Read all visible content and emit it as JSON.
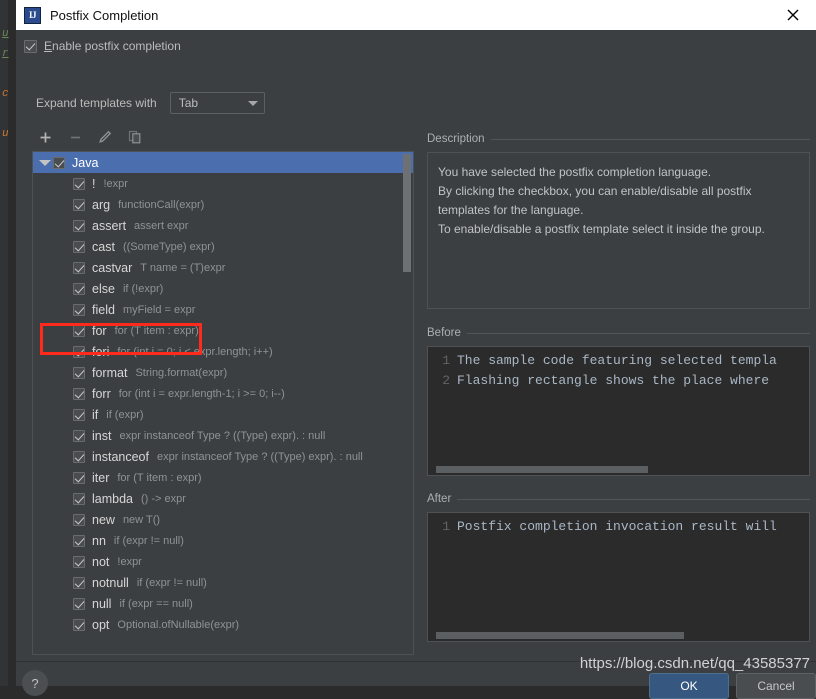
{
  "window": {
    "title": "Postfix Completion",
    "icon": "intellij-idea-icon",
    "close_icon": "close-icon"
  },
  "options": {
    "enable_checkbox_label": "Enable postfix completion",
    "enable_checkbox_mnemonic": "E",
    "enable_checked": true,
    "expand_label": "Expand templates with",
    "expand_value": "Tab"
  },
  "tree_toolbar": {
    "buttons": [
      {
        "name": "add-button",
        "icon": "plus-icon",
        "enabled": true
      },
      {
        "name": "remove-button",
        "icon": "minus-icon",
        "enabled": false
      },
      {
        "name": "edit-button",
        "icon": "pencil-icon",
        "enabled": false
      },
      {
        "name": "copy-button",
        "icon": "copy-icon",
        "enabled": false
      }
    ]
  },
  "tree": {
    "group": {
      "label": "Java",
      "checked": true,
      "expanded": true,
      "selected": true
    },
    "items": [
      {
        "name": "!",
        "desc": "!expr",
        "checked": true
      },
      {
        "name": "arg",
        "desc": "functionCall(expr)",
        "checked": true
      },
      {
        "name": "assert",
        "desc": "assert expr",
        "checked": true
      },
      {
        "name": "cast",
        "desc": "((SomeType) expr)",
        "checked": true
      },
      {
        "name": "castvar",
        "desc": "T name = (T)expr",
        "checked": true
      },
      {
        "name": "else",
        "desc": "if (!expr)",
        "checked": true
      },
      {
        "name": "field",
        "desc": "myField = expr",
        "checked": true
      },
      {
        "name": "for",
        "desc": "for (T item : expr)",
        "checked": true,
        "highlighted": true
      },
      {
        "name": "fori",
        "desc": "for (int i = 0; i < expr.length; i++)",
        "checked": true
      },
      {
        "name": "format",
        "desc": "String.format(expr)",
        "checked": true
      },
      {
        "name": "forr",
        "desc": "for (int i = expr.length-1; i >= 0; i--)",
        "checked": true
      },
      {
        "name": "if",
        "desc": "if (expr)",
        "checked": true
      },
      {
        "name": "inst",
        "desc": "expr instanceof Type ? ((Type) expr). : null",
        "checked": true
      },
      {
        "name": "instanceof",
        "desc": "expr instanceof Type ? ((Type) expr). : null",
        "checked": true
      },
      {
        "name": "iter",
        "desc": "for (T item : expr)",
        "checked": true
      },
      {
        "name": "lambda",
        "desc": "() -> expr",
        "checked": true
      },
      {
        "name": "new",
        "desc": "new T()",
        "checked": true
      },
      {
        "name": "nn",
        "desc": "if (expr != null)",
        "checked": true
      },
      {
        "name": "not",
        "desc": "!expr",
        "checked": true
      },
      {
        "name": "notnull",
        "desc": "if (expr != null)",
        "checked": true
      },
      {
        "name": "null",
        "desc": "if (expr == null)",
        "checked": true
      },
      {
        "name": "opt",
        "desc": "Optional.ofNullable(expr)",
        "checked": true
      }
    ]
  },
  "description": {
    "title": "Description",
    "lines": [
      "You have selected the postfix completion language.",
      "By clicking the checkbox, you can enable/disable all postfix",
      "templates for the language.",
      "To enable/disable a postfix template select it inside the group."
    ]
  },
  "before": {
    "title": "Before",
    "lines": [
      {
        "num": "1",
        "text": "The sample code featuring selected templa"
      },
      {
        "num": "2",
        "text": " Flashing rectangle shows the place where"
      }
    ]
  },
  "after": {
    "title": "After",
    "lines": [
      {
        "num": "1",
        "text": "Postfix completion invocation result will"
      }
    ]
  },
  "footer": {
    "help_label": "?",
    "ok_label": "OK",
    "cancel_label": "Cancel"
  },
  "watermark": "https://blog.csdn.net/qq_43585377",
  "colors": {
    "dialog_bg": "#3c3f41",
    "selection_blue": "#4b6eaf",
    "ok_button": "#365880",
    "annotation_red": "#ff2a1c",
    "code_bg": "#2b2b2b",
    "titlebar_bg": "#ffffff"
  },
  "background_editor": {
    "fragments": [
      "u",
      "r",
      "c",
      "u"
    ]
  }
}
